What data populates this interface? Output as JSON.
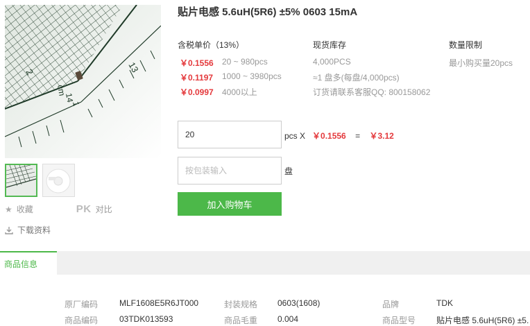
{
  "product": {
    "title": "贴片电感 5.6uH(5R6) ±5% 0603 15mA"
  },
  "image": {
    "ruler_labels": [
      "2",
      "13",
      "cm",
      "14",
      "1"
    ]
  },
  "actions": {
    "favorite": "收藏",
    "pk": "PK",
    "compare": "对比",
    "download": "下载资料"
  },
  "pricing": {
    "header": "含税单价（13%）",
    "tiers": [
      {
        "price": "￥0.1556",
        "range": "20 ~ 980pcs"
      },
      {
        "price": "￥0.1197",
        "range": "1000 ~ 3980pcs"
      },
      {
        "price": "￥0.0997",
        "range": "4000以上"
      }
    ]
  },
  "stock": {
    "header": "现货库存",
    "lines": [
      "4,000PCS",
      "≈1 盘多(每盘/4,000pcs)",
      "订货请联系客服QQ: 800158062"
    ]
  },
  "limit": {
    "header": "数量限制",
    "text": "最小购买量20pcs"
  },
  "order": {
    "quantity": "20",
    "pcs_label": "pcs X",
    "unit_price": "￥0.1556",
    "equals": "=",
    "total": "￥3.12",
    "reel_placeholder": "按包装输入",
    "reel_unit": "盘",
    "cart_button": "加入购物车"
  },
  "tabs": {
    "active": "商品信息"
  },
  "specs": [
    {
      "label": "原厂编码",
      "value": "MLF1608E5R6JT000"
    },
    {
      "label": "封装规格",
      "value": "0603(1608)"
    },
    {
      "label": "品牌",
      "value": "TDK"
    },
    {
      "label": "商品编码",
      "value": "03TDK013593"
    },
    {
      "label": "商品毛重",
      "value": "0.004"
    },
    {
      "label": "商品型号",
      "value": "贴片电感 5.6uH(5R6) ±5."
    }
  ],
  "colors": {
    "accent_green": "#4cb849",
    "price_red": "#e4393c"
  }
}
